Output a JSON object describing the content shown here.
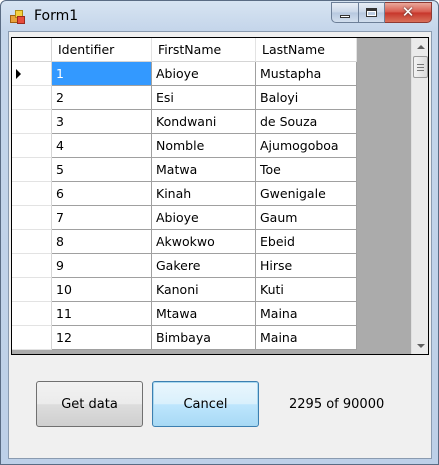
{
  "window": {
    "title": "Form1"
  },
  "grid": {
    "columns": [
      "Identifier",
      "FirstName",
      "LastName"
    ],
    "rows": [
      [
        "1",
        "Abioye",
        "Mustapha"
      ],
      [
        "2",
        "Esi",
        "Baloyi"
      ],
      [
        "3",
        "Kondwani",
        "de Souza"
      ],
      [
        "4",
        "Nomble",
        "Ajumogoboa"
      ],
      [
        "5",
        "Matwa",
        "Toe"
      ],
      [
        "6",
        "Kinah",
        "Gwenigale"
      ],
      [
        "7",
        "Abioye",
        "Gaum"
      ],
      [
        "8",
        "Akwokwo",
        "Ebeid"
      ],
      [
        "9",
        "Gakere",
        "Hirse"
      ],
      [
        "10",
        "Kanoni",
        "Kuti"
      ],
      [
        "11",
        "Mtawa",
        "Maina"
      ],
      [
        "12",
        "Bimbaya",
        "Maina"
      ]
    ],
    "selected_row": 0
  },
  "buttons": {
    "get_data": "Get data",
    "cancel": "Cancel"
  },
  "status": {
    "progress_text": "2295 of 90000"
  }
}
